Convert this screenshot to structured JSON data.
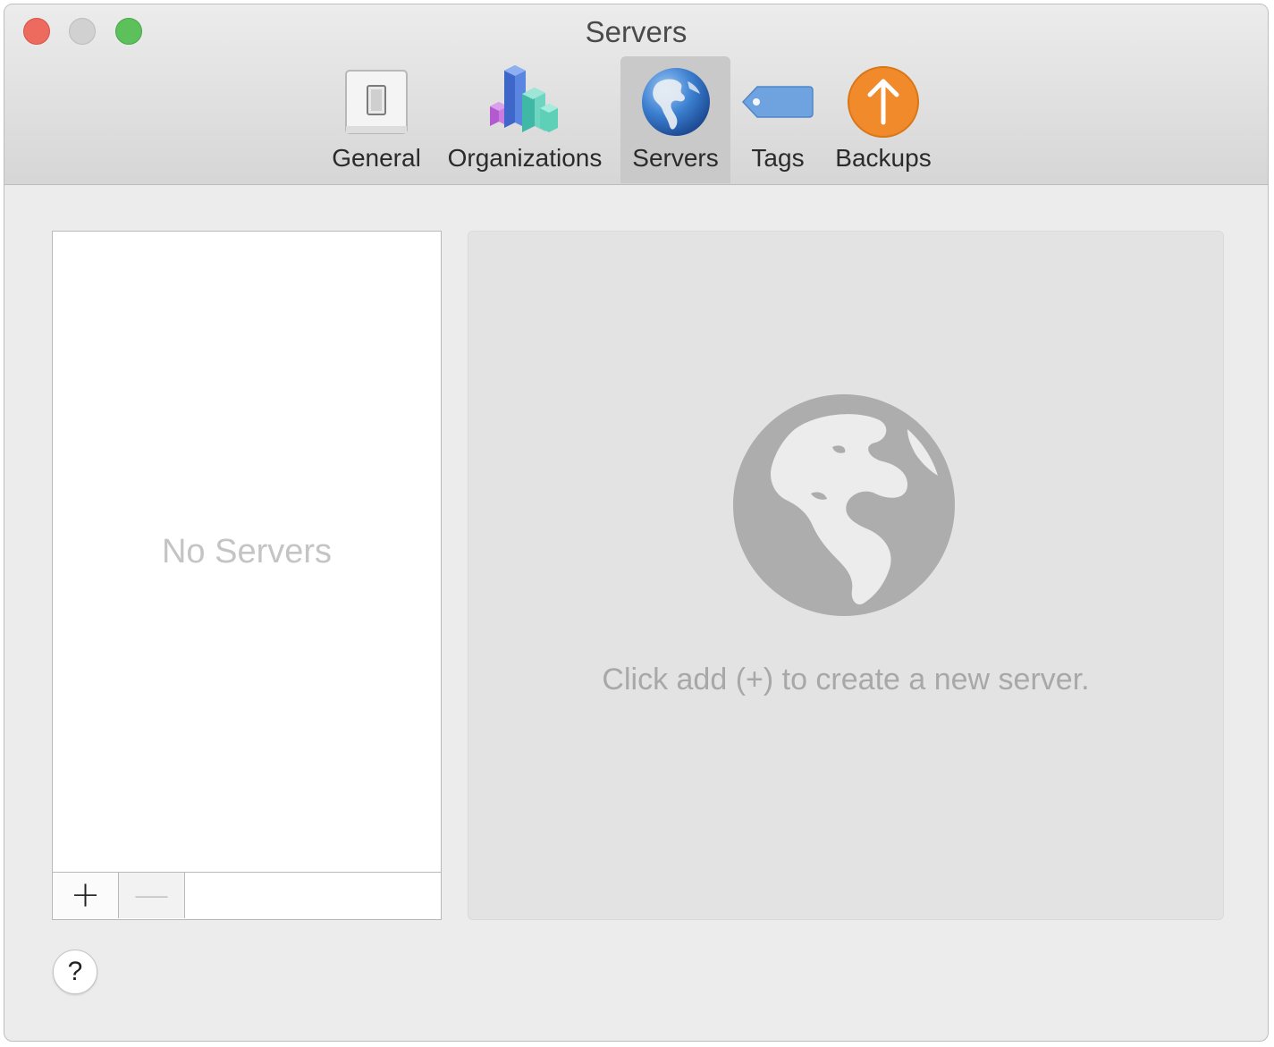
{
  "window": {
    "title": "Servers"
  },
  "toolbar": {
    "tabs": [
      {
        "label": "General",
        "icon": "switch-icon",
        "selected": false
      },
      {
        "label": "Organizations",
        "icon": "blocks-chart-icon",
        "selected": false
      },
      {
        "label": "Servers",
        "icon": "globe-icon",
        "selected": true
      },
      {
        "label": "Tags",
        "icon": "tag-icon",
        "selected": false
      },
      {
        "label": "Backups",
        "icon": "upload-arrow-icon",
        "selected": false
      }
    ]
  },
  "server_list": {
    "empty_text": "No Servers",
    "add_label": "+",
    "remove_label": "—"
  },
  "detail": {
    "hint": "Click add (+) to create a new server."
  },
  "help": {
    "label": "?"
  },
  "colors": {
    "close": "#ec6a5e",
    "minimize": "#d1d1d1",
    "maximize": "#5cc15b",
    "backups_orange": "#f08a2a",
    "tag_blue": "#6fa3e0",
    "globe_blue": "#2f6fc2"
  }
}
